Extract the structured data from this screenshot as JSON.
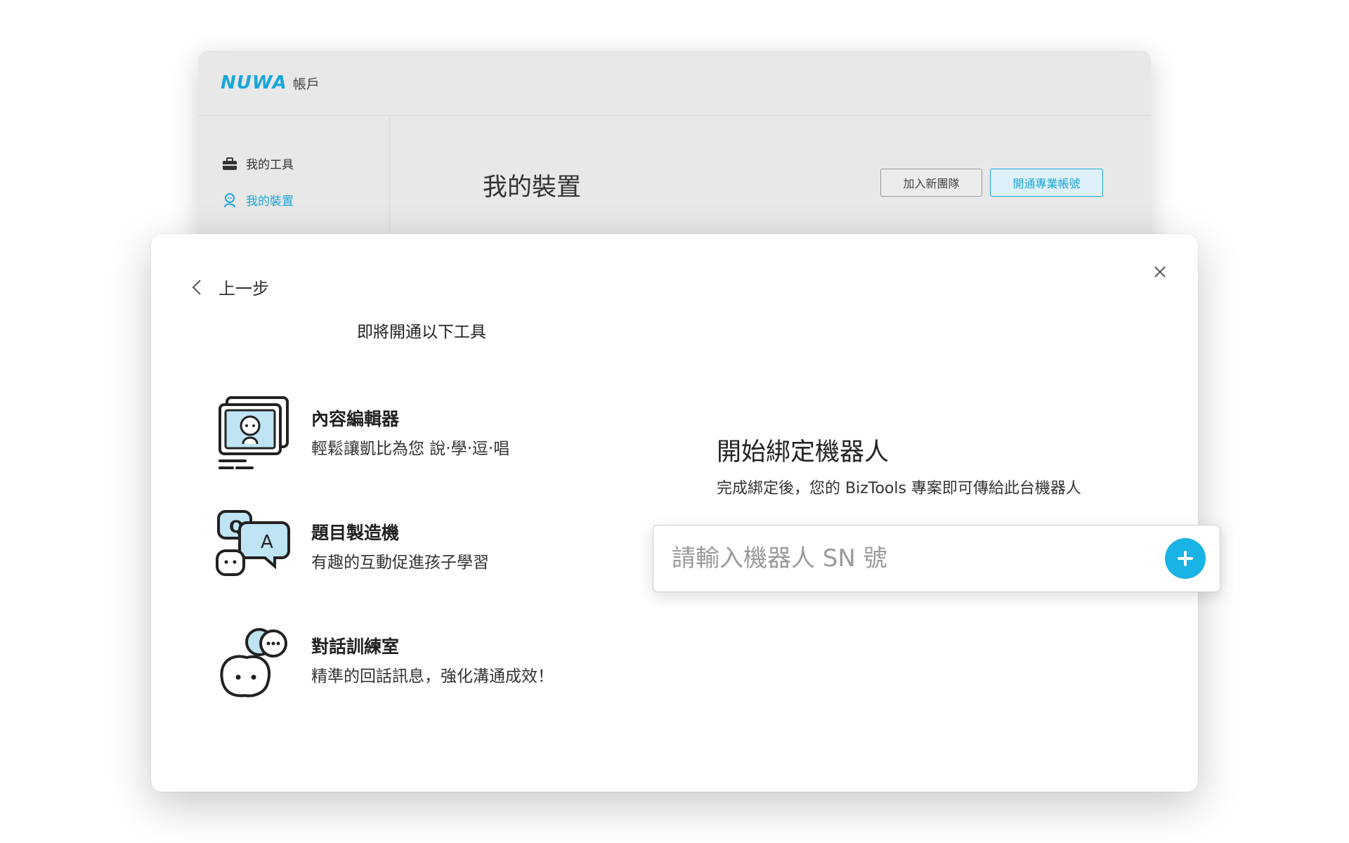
{
  "background_window": {
    "logo": "NUWA",
    "logo_subtitle": "帳戶",
    "sidebar": {
      "items": [
        {
          "label": "我的工具",
          "icon": "toolbox-icon",
          "active": false
        },
        {
          "label": "我的裝置",
          "icon": "robot-icon",
          "active": true
        }
      ]
    },
    "page_title": "我的裝置",
    "buttons": {
      "join_team": "加入新團隊",
      "activate_pro": "開通專業帳號"
    }
  },
  "modal": {
    "back_label": "上一步",
    "subtitle": "即將開通以下工具",
    "tools": [
      {
        "name": "內容編輯器",
        "description": "輕鬆讓凱比為您 說‧學‧逗‧唱",
        "icon": "content-editor-icon"
      },
      {
        "name": "題目製造機",
        "description": "有趣的互動促進孩子學習",
        "icon": "qa-maker-icon"
      },
      {
        "name": "對話訓練室",
        "description": "精準的回話訊息，強化溝通成效！",
        "icon": "dialog-training-icon"
      }
    ],
    "bind": {
      "title": "開始綁定機器人",
      "description": "完成綁定後，您的 BizTools 專案即可傳給此台機器人",
      "input_placeholder": "請輸入機器人 SN 號",
      "input_value": ""
    }
  },
  "colors": {
    "accent": "#1ab3e6",
    "brand": "#1aa7d8",
    "text": "#222222"
  }
}
